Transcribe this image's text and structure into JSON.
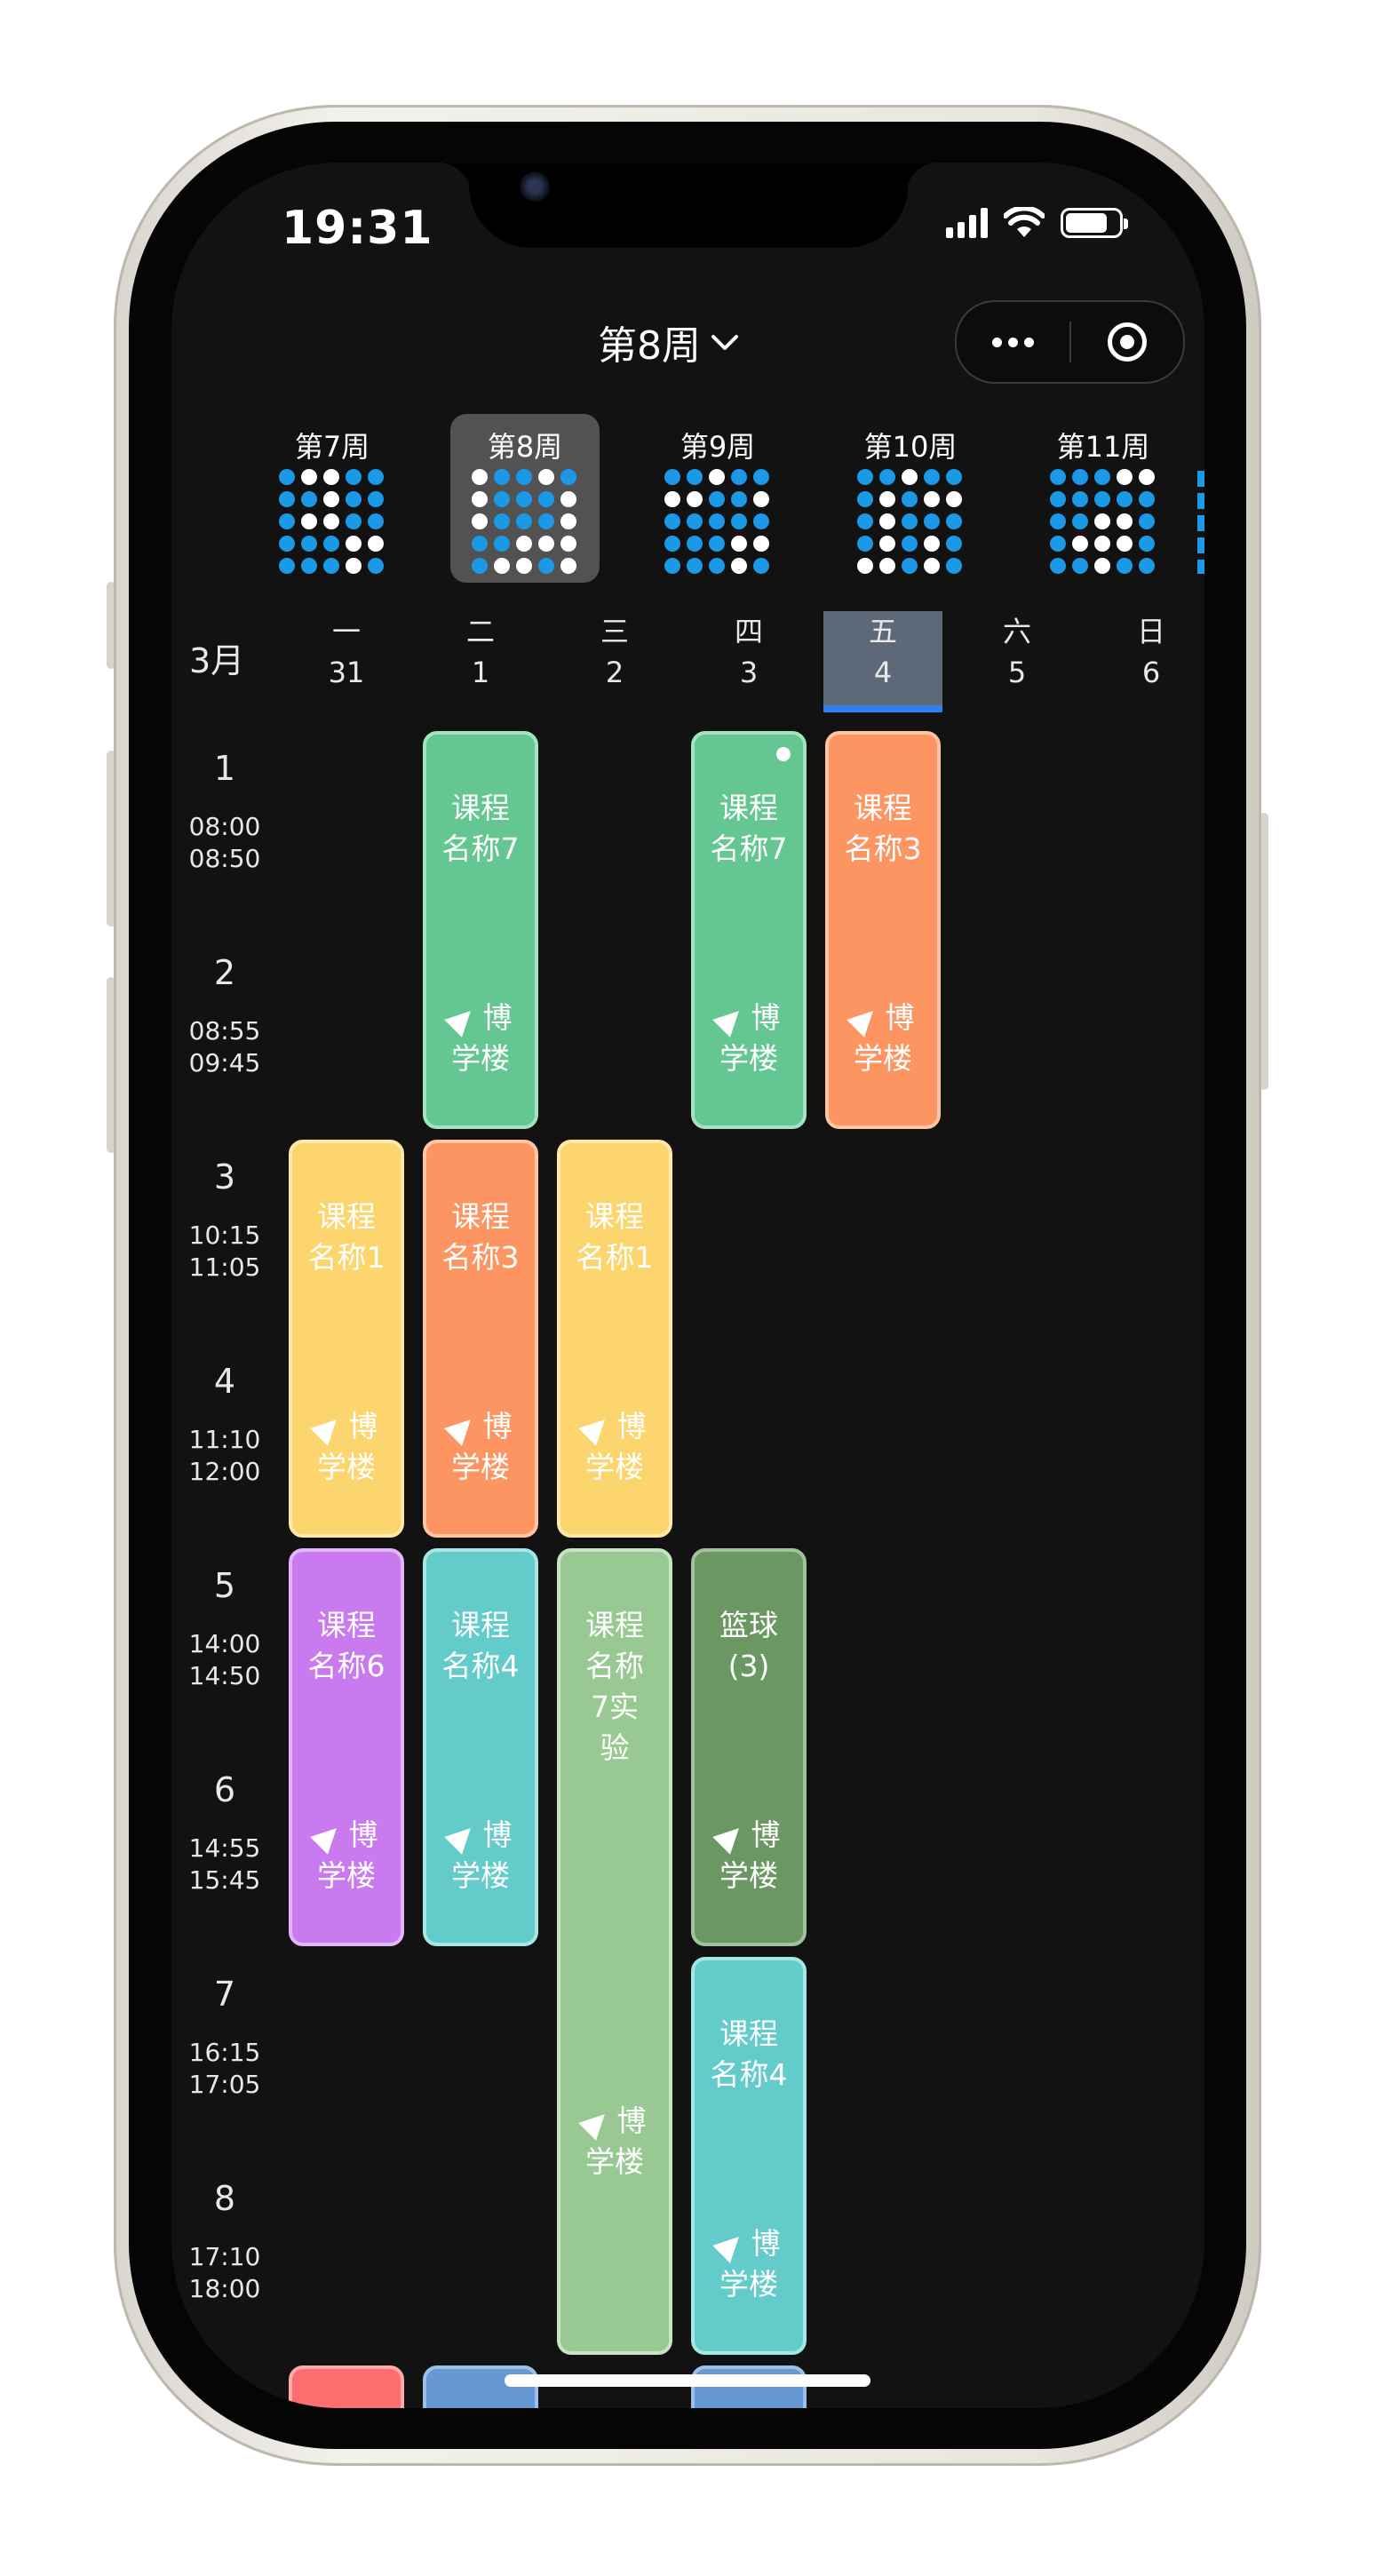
{
  "status_bar": {
    "time": "19:31"
  },
  "header": {
    "week_title": "第8周"
  },
  "weeks": [
    {
      "label": "第7周",
      "active": false,
      "pattern": "1001111011100111110011101"
    },
    {
      "label": "第8周",
      "active": true,
      "pattern": "0110101110011101100010010"
    },
    {
      "label": "第9周",
      "active": false,
      "pattern": "1101100110111111110011101"
    },
    {
      "label": "第10周",
      "active": false,
      "pattern": "1101110100101111010100101"
    },
    {
      "label": "第11周",
      "active": false,
      "pattern": "1110011111110011000111011"
    }
  ],
  "calendar": {
    "month": "3月",
    "days": [
      {
        "name": "一",
        "date": "31"
      },
      {
        "name": "二",
        "date": "1"
      },
      {
        "name": "三",
        "date": "2"
      },
      {
        "name": "四",
        "date": "3"
      },
      {
        "name": "五",
        "date": "4",
        "today": true
      },
      {
        "name": "六",
        "date": "5"
      },
      {
        "name": "日",
        "date": "6"
      }
    ],
    "periods": [
      {
        "n": "1",
        "start": "08:00",
        "end": "08:50"
      },
      {
        "n": "2",
        "start": "08:55",
        "end": "09:45"
      },
      {
        "n": "3",
        "start": "10:15",
        "end": "11:05"
      },
      {
        "n": "4",
        "start": "11:10",
        "end": "12:00"
      },
      {
        "n": "5",
        "start": "14:00",
        "end": "14:50"
      },
      {
        "n": "6",
        "start": "14:55",
        "end": "15:45"
      },
      {
        "n": "7",
        "start": "16:15",
        "end": "17:05"
      },
      {
        "n": "8",
        "start": "17:10",
        "end": "18:00"
      }
    ]
  },
  "courses": [
    {
      "day": 1,
      "start": 1,
      "span": 2,
      "name": "课程名称7",
      "loc_a": "博",
      "loc_b": "学楼",
      "color": "#64c791",
      "border": "#a5e3c0"
    },
    {
      "day": 3,
      "start": 1,
      "span": 2,
      "name": "课程名称7",
      "loc_a": "博",
      "loc_b": "学楼",
      "color": "#64c791",
      "border": "#a5e3c0",
      "dot": true
    },
    {
      "day": 4,
      "start": 1,
      "span": 2,
      "name": "课程名称3",
      "loc_a": "博",
      "loc_b": "学楼",
      "color": "#fd9563",
      "border": "#ffc4a4"
    },
    {
      "day": 0,
      "start": 3,
      "span": 2,
      "name": "课程名称1",
      "loc_a": "博",
      "loc_b": "学楼",
      "color": "#fdd56e",
      "border": "#ffe9a8"
    },
    {
      "day": 1,
      "start": 3,
      "span": 2,
      "name": "课程名称3",
      "loc_a": "博",
      "loc_b": "学楼",
      "color": "#fd9563",
      "border": "#ffc4a4"
    },
    {
      "day": 2,
      "start": 3,
      "span": 2,
      "name": "课程名称1",
      "loc_a": "博",
      "loc_b": "学楼",
      "color": "#fdd56e",
      "border": "#ffe9a8"
    },
    {
      "day": 0,
      "start": 5,
      "span": 2,
      "name": "课程名称6",
      "loc_a": "博",
      "loc_b": "学楼",
      "color": "#c97aee",
      "border": "#e3b7f7"
    },
    {
      "day": 1,
      "start": 5,
      "span": 2,
      "name": "课程名称4",
      "loc_a": "博",
      "loc_b": "学楼",
      "color": "#63cbc9",
      "border": "#a6e6e4"
    },
    {
      "day": 2,
      "start": 5,
      "span": 4,
      "name": "课程名称7实验",
      "loc_a": "博",
      "loc_b": "学楼",
      "color": "#99c993",
      "border": "#c6e3c2"
    },
    {
      "day": 3,
      "start": 5,
      "span": 2,
      "name": "篮球(3)",
      "loc_a": "博",
      "loc_b": "学楼",
      "color": "#6a9762",
      "border": "#a0c29a"
    },
    {
      "day": 3,
      "start": 7,
      "span": 2,
      "name": "课程名称4",
      "loc_a": "博",
      "loc_b": "学楼",
      "color": "#63cbc9",
      "border": "#a6e6e4"
    }
  ],
  "partial_courses": [
    {
      "day": 0,
      "color": "#fd6f6f",
      "border": "#ffa9a9"
    },
    {
      "day": 1,
      "color": "#6698d4",
      "border": "#9cbfe8"
    },
    {
      "day": 3,
      "color": "#6698d4",
      "border": "#9cbfe8"
    }
  ]
}
